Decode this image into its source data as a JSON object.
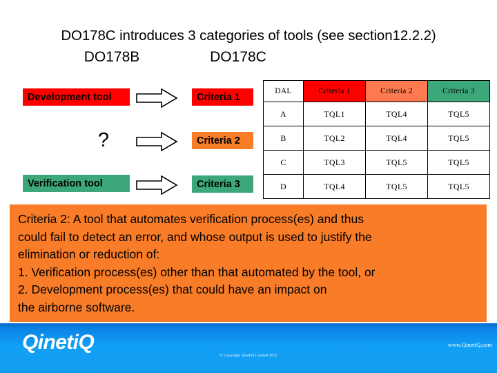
{
  "slide": {
    "title": "DO178C introduces 3 categories of tools (see section12.2.2)",
    "subtitle_left": "DO178B",
    "subtitle_right": "DO178C"
  },
  "flow": {
    "rows": [
      {
        "source_label": "Development tool",
        "target_label": "Criteria 1",
        "arrow": "right-arrow-icon"
      },
      {
        "source_label": "?",
        "target_label": "Criteria 2",
        "arrow": "right-arrow-icon"
      },
      {
        "source_label": "Verification tool",
        "target_label": "Criteria 3",
        "arrow": "right-arrow-icon"
      }
    ]
  },
  "table": {
    "headers": [
      "DAL",
      "Criteria 1",
      "Criteria 2",
      "Criteria 3"
    ],
    "rows": [
      [
        "A",
        "TQL1",
        "TQL4",
        "TQL5"
      ],
      [
        "B",
        "TQL2",
        "TQL4",
        "TQL5"
      ],
      [
        "C",
        "TQL3",
        "TQL5",
        "TQL5"
      ],
      [
        "D",
        "TQL4",
        "TQL5",
        "TQL5"
      ]
    ]
  },
  "callout": {
    "line1": "Criteria 2: A tool that automates verification process(es) and thus",
    "line2": "could fail to detect an error, and whose output is used to justify the",
    "line3": "elimination or reduction of:",
    "line4": "1. Verification process(es) other than that automated by the tool, or",
    "line5": "2. Development process(es) that could have an impact on",
    "line6": "the airborne software."
  },
  "footer": {
    "logo": "QinetiQ",
    "url": "www.QinetiQ.com",
    "copyright": "© Copyright QinetiQ Limited 2012"
  },
  "colors": {
    "red": "#FF0000",
    "orange_box": "#F97C28",
    "orange_header": "#FF7A50",
    "green": "#3CA87A",
    "footer_blue": "#12A0F5"
  }
}
